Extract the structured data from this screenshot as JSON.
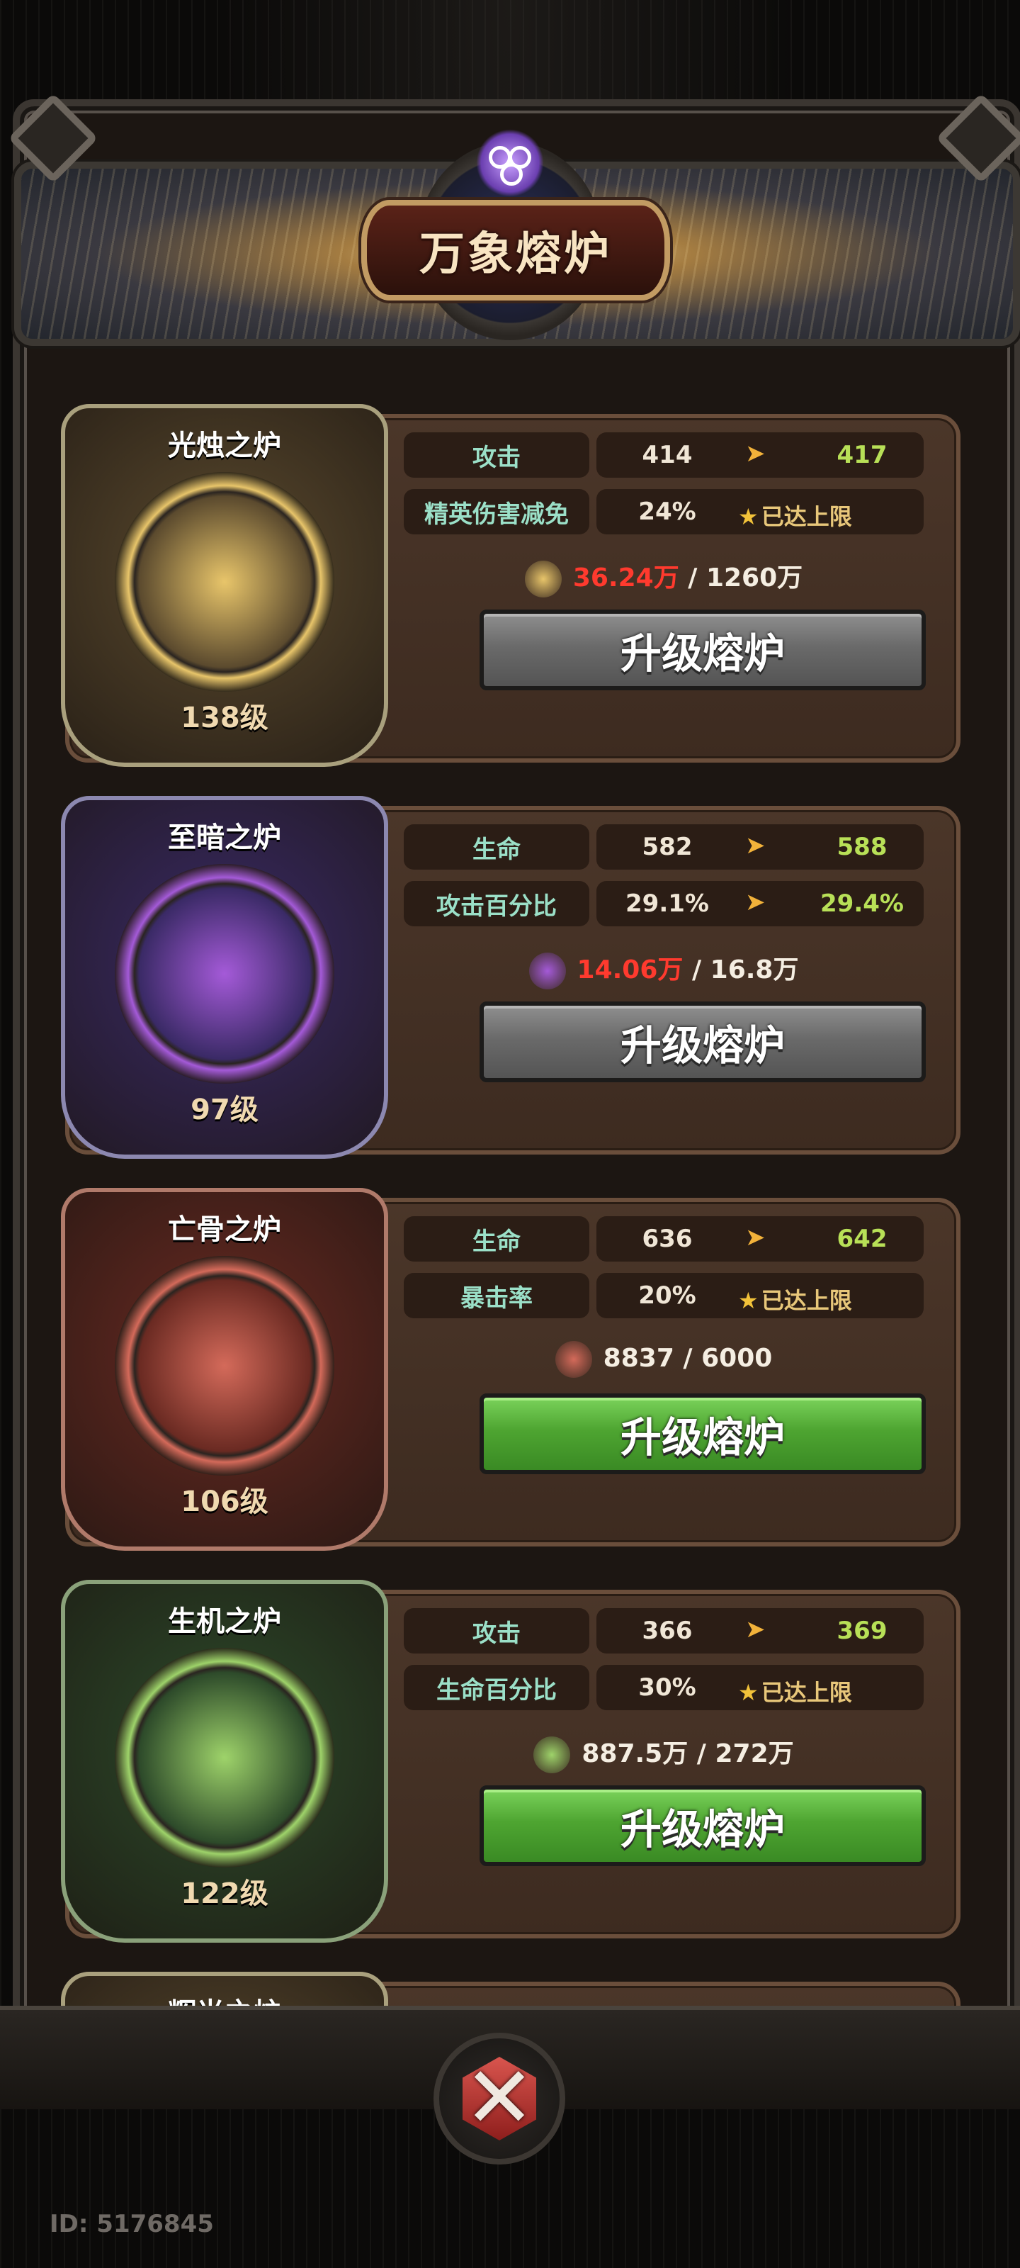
{
  "title": "万象熔炉",
  "furnaces": [
    {
      "name": "光烛之炉",
      "level": "138级",
      "theme": {
        "bg": "#5b4a2e",
        "icon": "#e8c56a",
        "border": "#a9a07d"
      },
      "stats": [
        {
          "label": "攻击",
          "from": "414",
          "to": "417"
        },
        {
          "label": "精英伤害减免",
          "value": "24%",
          "max": "已达上限"
        }
      ],
      "cost_icon": "exp-icon",
      "cost_current": "36.24万",
      "cost_separator": "/",
      "cost_required": "1260万",
      "cost_sufficient": false,
      "button": "升级熔炉"
    },
    {
      "name": "至暗之炉",
      "level": "97级",
      "theme": {
        "bg": "#3a2a66",
        "icon": "#a45ad8",
        "border": "#8c88b0"
      },
      "stats": [
        {
          "label": "生命",
          "from": "582",
          "to": "588"
        },
        {
          "label": "攻击百分比",
          "from": "29.1%",
          "to": "29.4%"
        }
      ],
      "cost_icon": "flower-icon",
      "cost_current": "14.06万",
      "cost_separator": "/",
      "cost_required": "16.8万",
      "cost_sufficient": false,
      "button": "升级熔炉"
    },
    {
      "name": "亡骨之炉",
      "level": "106级",
      "theme": {
        "bg": "#6a2a22",
        "icon": "#d46a5a",
        "border": "#b07a6a"
      },
      "stats": [
        {
          "label": "生命",
          "from": "636",
          "to": "642"
        },
        {
          "label": "暴击率",
          "value": "20%",
          "max": "已达上限"
        }
      ],
      "cost_icon": "bone-icon",
      "cost_current": "8837",
      "cost_separator": "/",
      "cost_required": "6000",
      "cost_sufficient": true,
      "button": "升级熔炉"
    },
    {
      "name": "生机之炉",
      "level": "122级",
      "theme": {
        "bg": "#2d4a2a",
        "icon": "#9ed36a",
        "border": "#8aa17a"
      },
      "stats": [
        {
          "label": "攻击",
          "from": "366",
          "to": "369"
        },
        {
          "label": "生命百分比",
          "value": "30%",
          "max": "已达上限"
        }
      ],
      "cost_icon": "coin-icon",
      "cost_current": "887.5万",
      "cost_separator": "/",
      "cost_required": "272万",
      "cost_sufficient": true,
      "button": "升级熔炉"
    },
    {
      "name": "辉光之炉",
      "level": "",
      "theme": {
        "bg": "#5b4a2e",
        "icon": "#e8c56a",
        "border": "#a9a07d"
      },
      "stats": [],
      "partial": true
    }
  ],
  "player_id": "ID: 5176845",
  "colors": {
    "stat_label": "#9be0c8",
    "next_value": "#b8e057",
    "insufficient": "#ff3a2e",
    "max_text": "#e8c77a"
  }
}
